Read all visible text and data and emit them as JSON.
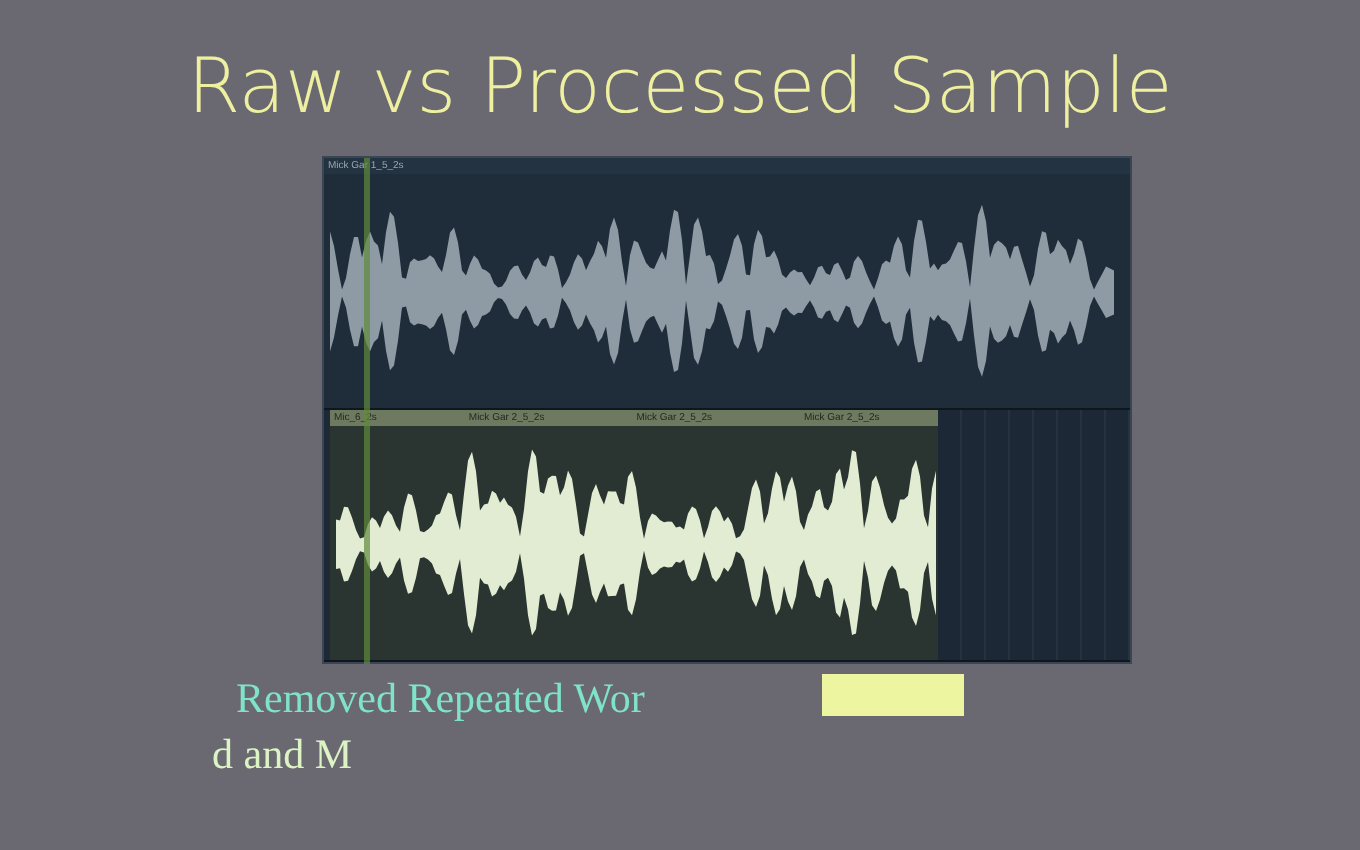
{
  "slide": {
    "title": "Raw vs Processed Sample"
  },
  "daw": {
    "tracks": [
      {
        "kind": "raw",
        "clips": [
          {
            "label": "Mick Gar 1_5_2s"
          }
        ]
      },
      {
        "kind": "processed",
        "clips": [
          {
            "label": "Mic_6_2s"
          },
          {
            "label": "Mick Gar 2_5_2s"
          },
          {
            "label": "Mick Gar 2_5_2s"
          },
          {
            "label": "Mick Gar 2_5_2s"
          }
        ]
      }
    ]
  },
  "captions": [
    {
      "text": "Removed Repeated Wor",
      "kind": "accent"
    },
    {
      "text": "d and M",
      "kind": "plain"
    }
  ]
}
